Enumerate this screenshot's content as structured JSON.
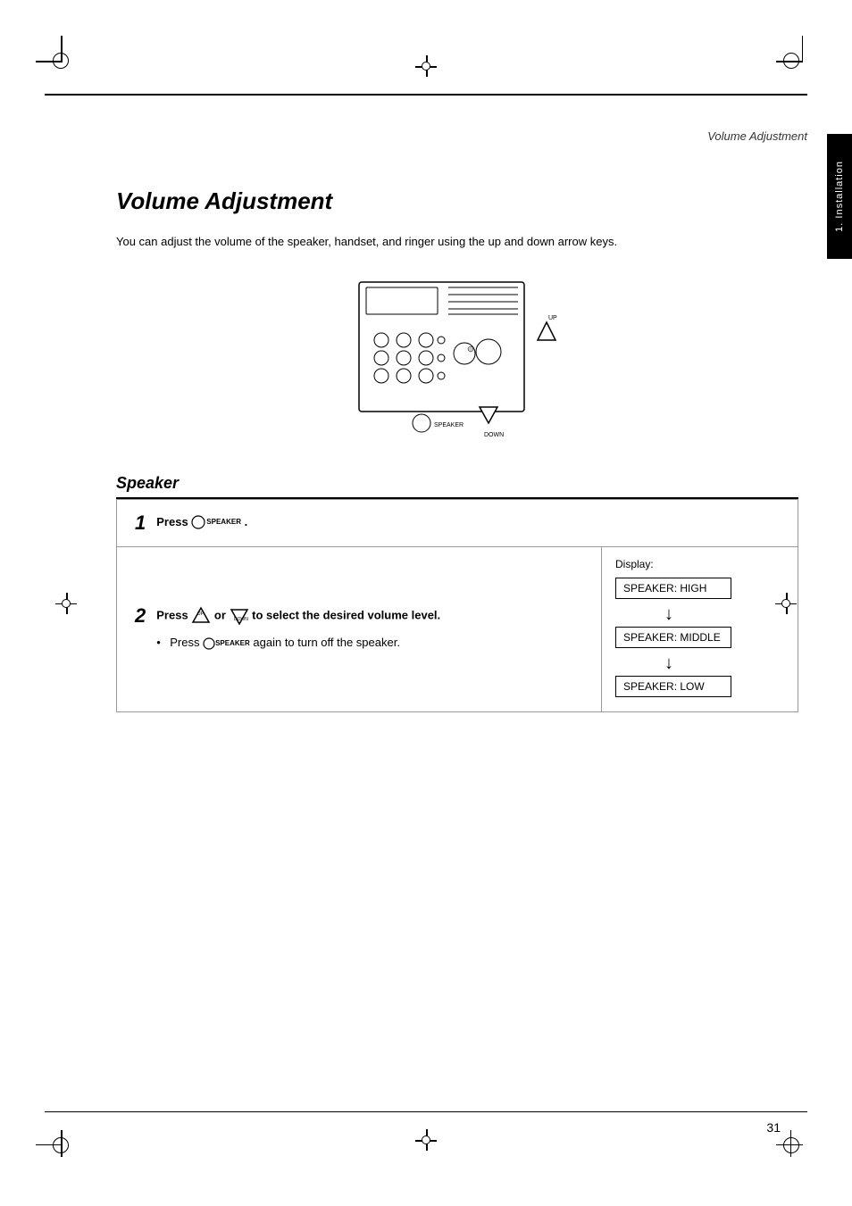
{
  "page": {
    "number": "31",
    "header_label": "Volume Adjustment",
    "side_tab": "1. Installation"
  },
  "title": "Volume Adjustment",
  "intro": "You can adjust the volume of the speaker, handset, and ringer using the up and down arrow keys.",
  "section": {
    "title": "Speaker"
  },
  "steps": [
    {
      "number": "1",
      "text_prefix": "Press",
      "icon": "SPEAKER",
      "text_suffix": ".",
      "has_display": false
    },
    {
      "number": "2",
      "text_main_bold": "Press  or  to select the desired volume level.",
      "bullet": "Press  SPEAKER  again to turn off the speaker.",
      "display_label": "Display:",
      "display_items": [
        "SPEAKER: HIGH",
        "SPEAKER: MIDDLE",
        "SPEAKER: LOW"
      ]
    }
  ]
}
